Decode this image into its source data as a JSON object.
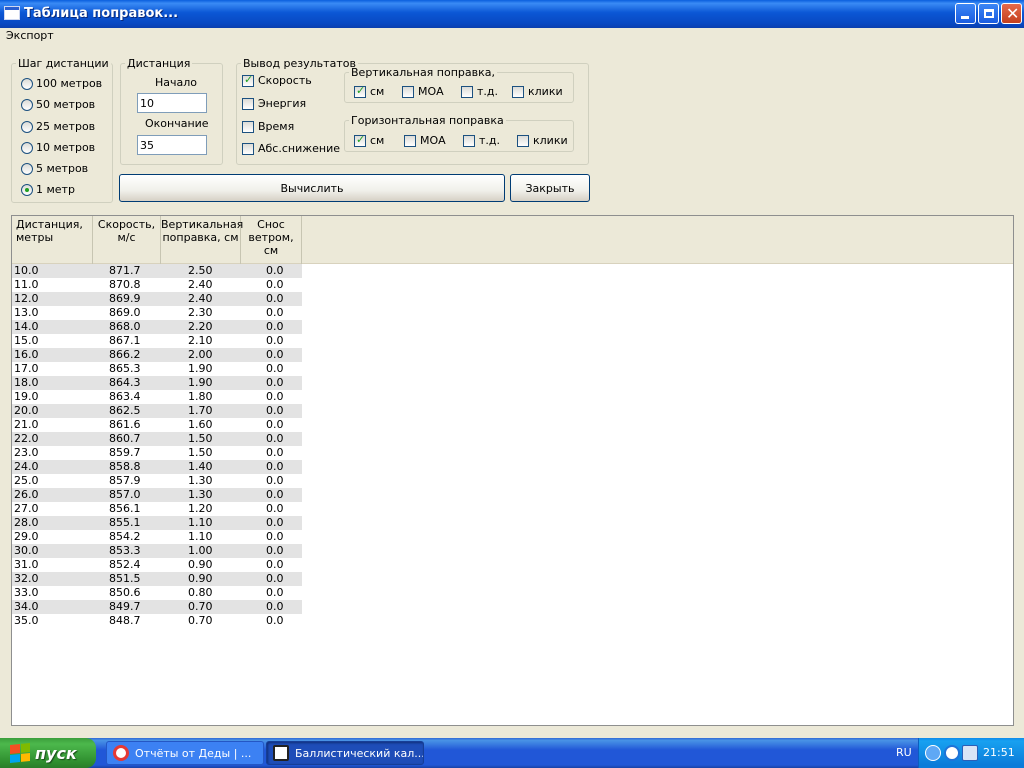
{
  "window": {
    "title": "Таблица поправок..."
  },
  "menu": {
    "export": "Экспорт"
  },
  "step_group": {
    "legend": "Шаг дистанции",
    "options": [
      "100 метров",
      "50 метров",
      "25 метров",
      "10 метров",
      "5 метров",
      "1 метр"
    ],
    "selected": "1 метр"
  },
  "distance_group": {
    "legend": "Дистанция",
    "start_label": "Начало",
    "start_value": "10",
    "end_label": "Окончание",
    "end_value": "35"
  },
  "output_group": {
    "legend": "Вывод результатов",
    "speed": "Скорость",
    "energy": "Энергия",
    "time": "Время",
    "abs_drop": "Абс.снижение",
    "checked": {
      "speed": true,
      "energy": false,
      "time": false,
      "abs_drop": false
    }
  },
  "vertical_group": {
    "legend": "Вертикальная поправка,",
    "cm": "см",
    "moa": "МОА",
    "td": "т.д.",
    "clicks": "клики",
    "checked": {
      "cm": true,
      "moa": false,
      "td": false,
      "clicks": false
    }
  },
  "horizontal_group": {
    "legend": "Горизонтальная поправка",
    "cm": "см",
    "moa": "МОА",
    "td": "т.д.",
    "clicks": "клики",
    "checked": {
      "cm": true,
      "moa": false,
      "td": false,
      "clicks": false
    }
  },
  "buttons": {
    "calculate": "Вычислить",
    "close": "Закрыть"
  },
  "table": {
    "headers": [
      [
        "Дистанция,",
        "метры",
        ""
      ],
      [
        "Скорость,",
        "м/с",
        ""
      ],
      [
        "Вертикальная",
        "поправка, см",
        ""
      ],
      [
        "Снос",
        "ветром,",
        "см"
      ]
    ],
    "rows": [
      [
        "10.0",
        "871.7",
        "2.50",
        "0.0"
      ],
      [
        "11.0",
        "870.8",
        "2.40",
        "0.0"
      ],
      [
        "12.0",
        "869.9",
        "2.40",
        "0.0"
      ],
      [
        "13.0",
        "869.0",
        "2.30",
        "0.0"
      ],
      [
        "14.0",
        "868.0",
        "2.20",
        "0.0"
      ],
      [
        "15.0",
        "867.1",
        "2.10",
        "0.0"
      ],
      [
        "16.0",
        "866.2",
        "2.00",
        "0.0"
      ],
      [
        "17.0",
        "865.3",
        "1.90",
        "0.0"
      ],
      [
        "18.0",
        "864.3",
        "1.90",
        "0.0"
      ],
      [
        "19.0",
        "863.4",
        "1.80",
        "0.0"
      ],
      [
        "20.0",
        "862.5",
        "1.70",
        "0.0"
      ],
      [
        "21.0",
        "861.6",
        "1.60",
        "0.0"
      ],
      [
        "22.0",
        "860.7",
        "1.50",
        "0.0"
      ],
      [
        "23.0",
        "859.7",
        "1.50",
        "0.0"
      ],
      [
        "24.0",
        "858.8",
        "1.40",
        "0.0"
      ],
      [
        "25.0",
        "857.9",
        "1.30",
        "0.0"
      ],
      [
        "26.0",
        "857.0",
        "1.30",
        "0.0"
      ],
      [
        "27.0",
        "856.1",
        "1.20",
        "0.0"
      ],
      [
        "28.0",
        "855.1",
        "1.10",
        "0.0"
      ],
      [
        "29.0",
        "854.2",
        "1.10",
        "0.0"
      ],
      [
        "30.0",
        "853.3",
        "1.00",
        "0.0"
      ],
      [
        "31.0",
        "852.4",
        "0.90",
        "0.0"
      ],
      [
        "32.0",
        "851.5",
        "0.90",
        "0.0"
      ],
      [
        "33.0",
        "850.6",
        "0.80",
        "0.0"
      ],
      [
        "34.0",
        "849.7",
        "0.70",
        "0.0"
      ],
      [
        "35.0",
        "848.7",
        "0.70",
        "0.0"
      ]
    ]
  },
  "taskbar": {
    "start": "пуск",
    "tasks": [
      "Отчёты от Деды | ...",
      "Баллистический кал..."
    ],
    "language": "RU",
    "clock": "21:51"
  },
  "colors": {
    "title_bar": "#0B57D5",
    "start_button": "#3C9E3C",
    "window_bg": "#ECE9D8"
  }
}
